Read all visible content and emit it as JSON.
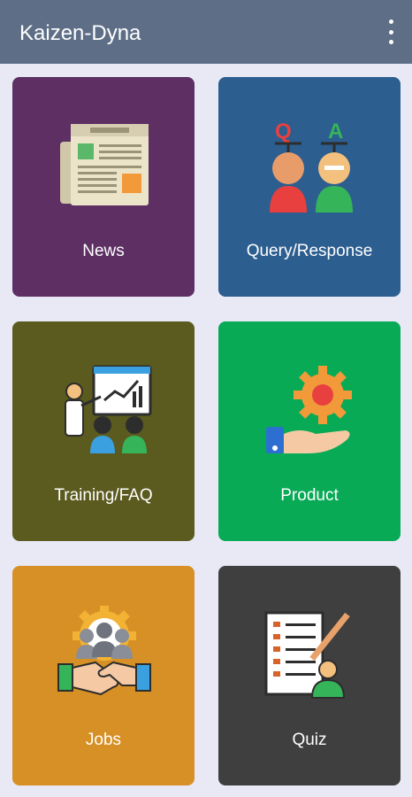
{
  "app": {
    "title": "Kaizen-Dyna"
  },
  "menu": {
    "icon": "overflow-menu-icon"
  },
  "tiles": [
    {
      "label": "News",
      "icon": "newspaper-icon",
      "color": "#5d2f63"
    },
    {
      "label": "Query/Response",
      "icon": "qa-people-icon",
      "color": "#2c5e8f"
    },
    {
      "label": "Training/FAQ",
      "icon": "training-presentation-icon",
      "color": "#5b5a1f"
    },
    {
      "label": "Product",
      "icon": "product-gear-hand-icon",
      "color": "#08aa56"
    },
    {
      "label": "Jobs",
      "icon": "handshake-gear-icon",
      "color": "#d79025"
    },
    {
      "label": "Quiz",
      "icon": "quiz-checklist-icon",
      "color": "#3f3f3f"
    }
  ],
  "icon_texts": {
    "q": "Q",
    "a": "A"
  }
}
